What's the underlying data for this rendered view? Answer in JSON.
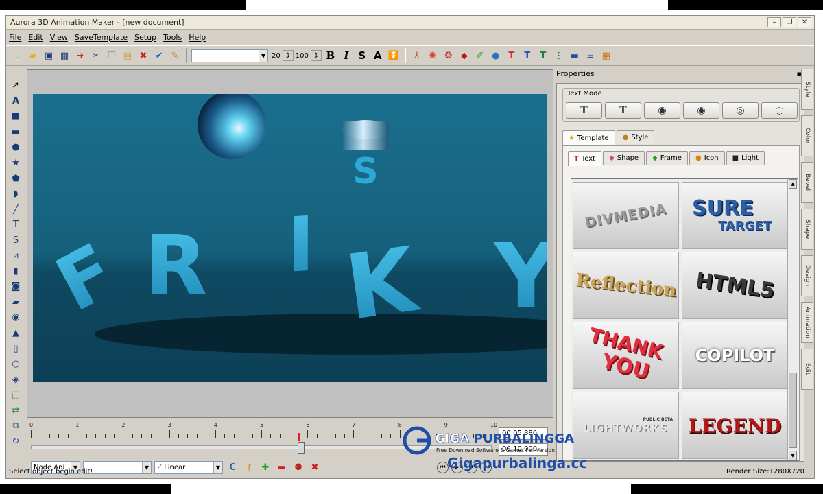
{
  "window": {
    "title": "Aurora 3D Animation Maker - [new document]"
  },
  "menu": [
    "File",
    "Edit",
    "View",
    "SaveTemplate",
    "Setup",
    "Tools",
    "Help"
  ],
  "toolbar": {
    "font_size_a": "20",
    "font_size_b": "100",
    "bold": "B",
    "italic": "I",
    "strike": "S",
    "shadow": "A"
  },
  "scene": {
    "letters": [
      "F",
      "R",
      "I",
      "K",
      "Y"
    ],
    "floating_text": "S"
  },
  "timeline": {
    "ticks": [
      "0",
      "1",
      "2",
      "3",
      "4",
      "5",
      "6",
      "7",
      "8",
      "9",
      "10"
    ],
    "time_current": "00:05.880",
    "time_total": "00:10.000"
  },
  "bottom_controls": {
    "node_mode": "Node Ani",
    "interp": "Linear"
  },
  "status": {
    "left": "Select object begin edit!",
    "right": "Render Size:1280X720"
  },
  "properties": {
    "header": "Properties",
    "text_mode_label": "Text Mode",
    "template_tab": "Template",
    "style_tab": "Style",
    "sub_tabs": [
      "Text",
      "Shape",
      "Frame",
      "Icon",
      "Light"
    ],
    "templates": [
      {
        "label": "DIVMEDIA"
      },
      {
        "label_top": "SURE",
        "label_bottom": "TARGET"
      },
      {
        "label": "Reflection"
      },
      {
        "label": "HTML5"
      },
      {
        "label_top": "THANK",
        "label_bottom": "YOU"
      },
      {
        "label": "COPILOT"
      },
      {
        "label": "LIGHTWORKS",
        "small": "PUBLIC BETA"
      },
      {
        "label": "LEGEND"
      }
    ]
  },
  "side_tabs": [
    "Style",
    "Color",
    "Bevel",
    "Shape",
    "Design",
    "Animation",
    "Edit"
  ],
  "watermark": {
    "brand_a": "GIGA",
    "brand_b": "PURBALINGGA",
    "tagline": "Free Download Software & Games Full Version",
    "url": "Gigapurbalinga.cc"
  }
}
